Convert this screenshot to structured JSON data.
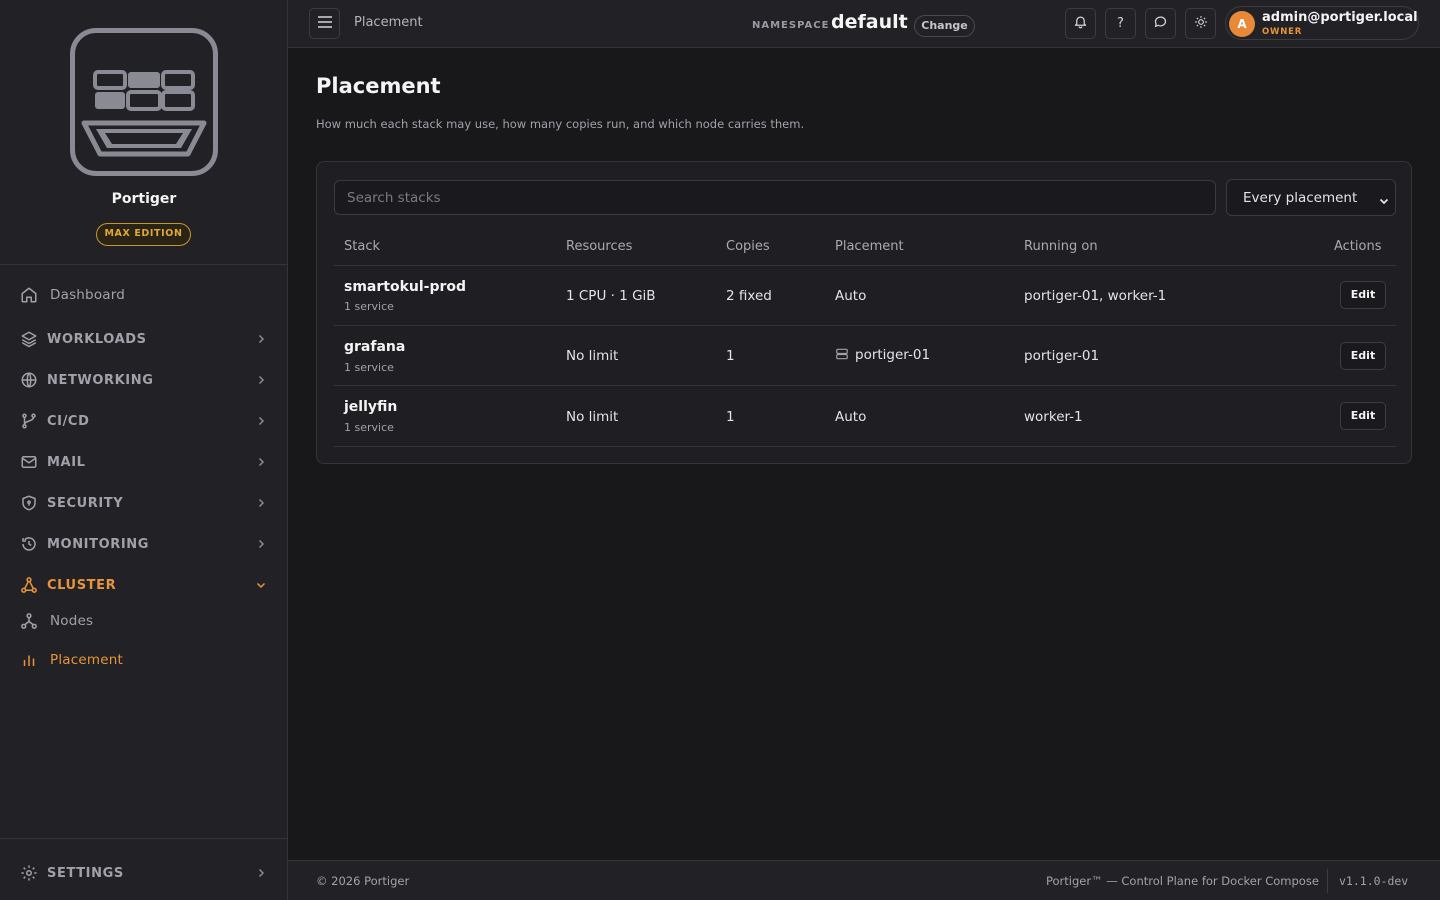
{
  "brand": {
    "name": "Portiger",
    "edition": "MAX EDITION"
  },
  "sidebar": {
    "dashboard": "Dashboard",
    "sections": [
      {
        "label": "WORKLOADS",
        "icon": "layers-icon"
      },
      {
        "label": "NETWORKING",
        "icon": "globe-icon"
      },
      {
        "label": "CI/CD",
        "icon": "git-icon"
      },
      {
        "label": "MAIL",
        "icon": "mail-icon"
      },
      {
        "label": "SECURITY",
        "icon": "shield-icon"
      },
      {
        "label": "MONITORING",
        "icon": "history-icon"
      },
      {
        "label": "CLUSTER",
        "icon": "cluster-icon",
        "expanded": true
      }
    ],
    "cluster_items": [
      {
        "label": "Nodes",
        "icon": "nodes-icon"
      },
      {
        "label": "Placement",
        "icon": "bar-chart-icon",
        "active": true
      }
    ],
    "settings": "SETTINGS"
  },
  "topbar": {
    "breadcrumb": "Placement",
    "namespace_label": "NAMESPACE",
    "namespace_value": "default",
    "change_label": "Change",
    "help_label": "?",
    "user": {
      "initial": "A",
      "email": "admin@portiger.local",
      "role": "OWNER"
    }
  },
  "main": {
    "title": "Placement",
    "subtitle": "How much each stack may use, how many copies run, and which node carries them.",
    "search_placeholder": "Search stacks",
    "filter_value": "Every placement",
    "columns": [
      "Stack",
      "Resources",
      "Copies",
      "Placement",
      "Running on",
      "Actions"
    ],
    "rows": [
      {
        "name": "smartokul-prod",
        "services": "1 service",
        "resources": "1 CPU · 1 GiB",
        "copies": "2 fixed",
        "placement": "Auto",
        "running_on": "portiger-01, worker-1",
        "action": "Edit"
      },
      {
        "name": "grafana",
        "services": "1 service",
        "resources": "No limit",
        "copies": "1",
        "placement": "portiger-01",
        "placement_icon": "server-icon",
        "running_on": "portiger-01",
        "action": "Edit"
      },
      {
        "name": "jellyfin",
        "services": "1 service",
        "resources": "No limit",
        "copies": "1",
        "placement": "Auto",
        "running_on": "worker-1",
        "action": "Edit"
      }
    ]
  },
  "footer": {
    "copyright": "© 2026 Portiger",
    "product": "Portiger™ — Control Plane for Docker Compose",
    "version": "v1.1.0-dev"
  },
  "colors": {
    "accent": "#e8943a",
    "background": "#18181b",
    "panel": "#222226",
    "edition": "#e0a83a"
  }
}
